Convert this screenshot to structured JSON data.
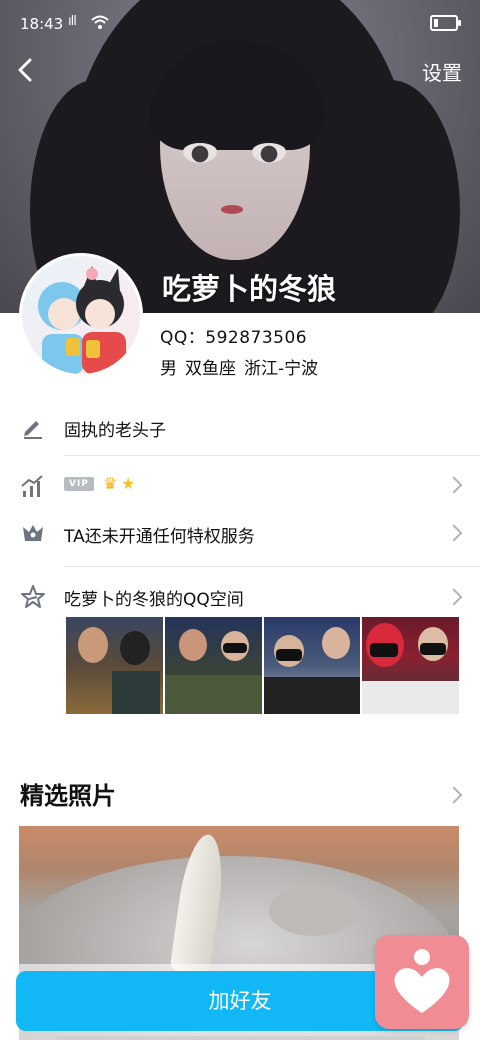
{
  "status_bar": {
    "time": "18:43",
    "signal": "ıll",
    "battery_percent": 15
  },
  "header": {
    "back_icon": "chevron-left-icon",
    "settings_label": "设置",
    "nickname": "吃萝卜的冬狼"
  },
  "profile": {
    "qq_label": "QQ：",
    "qq_number": "592873506",
    "gender": "男",
    "zodiac": "双鱼座",
    "location": "浙江-宁波"
  },
  "rows": {
    "signature": {
      "icon": "pencil-icon",
      "text": "固执的老头子"
    },
    "vip": {
      "icon": "level-chart-icon",
      "badge": "VIP",
      "crown_icon": "crown-icon",
      "star_icon": "star-icon"
    },
    "privilege": {
      "icon": "crown-outline-icon",
      "text": "TA还未开通任何特权服务"
    },
    "qzone": {
      "icon": "qzone-star-icon",
      "text": "吃萝卜的冬狼的QQ空间"
    }
  },
  "featured": {
    "title": "精选照片"
  },
  "actions": {
    "add_friend": "加好友",
    "like_icon": "heart-person-icon"
  },
  "colors": {
    "accent": "#12b7f5",
    "like_bg": "#f08c93",
    "icon_gray": "#6d7480"
  }
}
